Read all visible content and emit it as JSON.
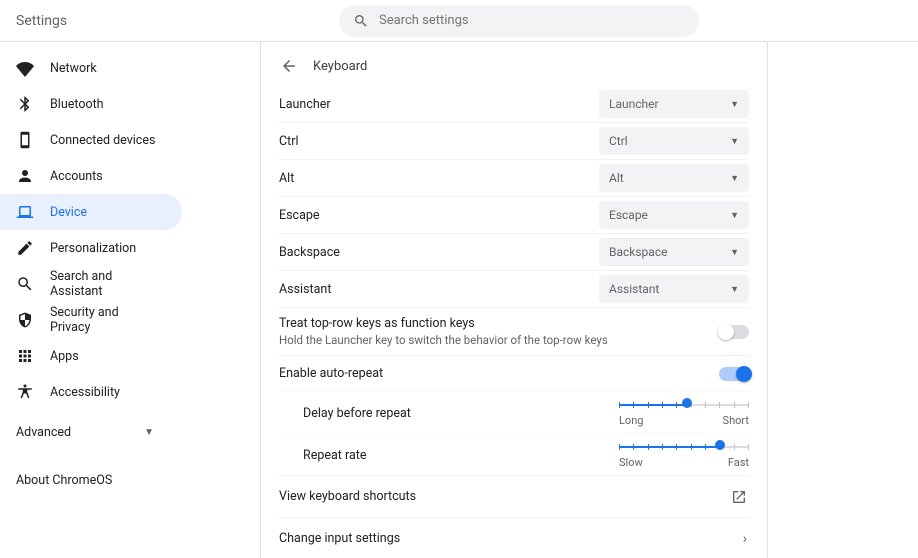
{
  "header": {
    "title": "Settings",
    "search_placeholder": "Search settings"
  },
  "sidebar": {
    "items": [
      {
        "id": "network",
        "label": "Network"
      },
      {
        "id": "bluetooth",
        "label": "Bluetooth"
      },
      {
        "id": "connected-devices",
        "label": "Connected devices"
      },
      {
        "id": "accounts",
        "label": "Accounts"
      },
      {
        "id": "device",
        "label": "Device"
      },
      {
        "id": "personalization",
        "label": "Personalization"
      },
      {
        "id": "search-assistant",
        "label": "Search and Assistant"
      },
      {
        "id": "security-privacy",
        "label": "Security and Privacy"
      },
      {
        "id": "apps",
        "label": "Apps"
      },
      {
        "id": "accessibility",
        "label": "Accessibility"
      }
    ],
    "advanced": "Advanced",
    "about": "About ChromeOS"
  },
  "content": {
    "title": "Keyboard",
    "key_map": [
      {
        "label": "Launcher",
        "value": "Launcher"
      },
      {
        "label": "Ctrl",
        "value": "Ctrl"
      },
      {
        "label": "Alt",
        "value": "Alt"
      },
      {
        "label": "Escape",
        "value": "Escape"
      },
      {
        "label": "Backspace",
        "value": "Backspace"
      },
      {
        "label": "Assistant",
        "value": "Assistant"
      }
    ],
    "fn_keys": {
      "title": "Treat top-row keys as function keys",
      "sub": "Hold the Launcher key to switch the behavior of the top-row keys",
      "on": false
    },
    "auto_repeat": {
      "title": "Enable auto-repeat",
      "on": true
    },
    "sliders": [
      {
        "label": "Delay before repeat",
        "min": "Long",
        "max": "Short",
        "value_pct": 52
      },
      {
        "label": "Repeat rate",
        "min": "Slow",
        "max": "Fast",
        "value_pct": 78
      }
    ],
    "shortcuts": "View keyboard shortcuts",
    "change_input": "Change input settings"
  }
}
